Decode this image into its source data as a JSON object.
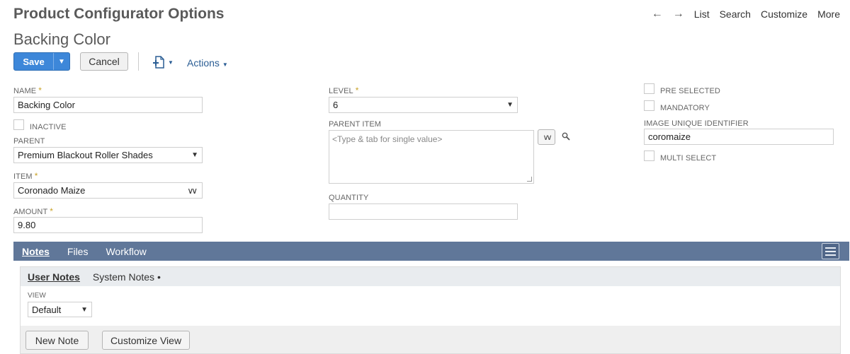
{
  "header": {
    "page_title": "Product Configurator Options",
    "record_name": "Backing Color",
    "nav": {
      "back_icon": "arrow-left-icon",
      "forward_icon": "arrow-right-icon",
      "list": "List",
      "search": "Search",
      "customize": "Customize",
      "more": "More"
    }
  },
  "toolbar": {
    "save_label": "Save",
    "cancel_label": "Cancel",
    "actions_label": "Actions",
    "accent_color": "#3d87d9"
  },
  "form": {
    "name": {
      "label": "NAME",
      "value": "Backing Color",
      "required": "*"
    },
    "inactive": {
      "label": "INACTIVE",
      "checked": false
    },
    "parent": {
      "label": "PARENT",
      "value": "Premium Blackout Roller Shades"
    },
    "item": {
      "label": "ITEM",
      "value": "Coronado Maize",
      "required": "*"
    },
    "amount": {
      "label": "AMOUNT",
      "value": "9.80",
      "required": "*"
    },
    "level": {
      "label": "LEVEL",
      "value": "6",
      "required": "*"
    },
    "parent_item": {
      "label": "PARENT ITEM",
      "placeholder": "<Type & tab for single value>"
    },
    "quantity": {
      "label": "QUANTITY",
      "value": ""
    },
    "pre_selected": {
      "label": "PRE SELECTED",
      "checked": false
    },
    "mandatory": {
      "label": "MANDATORY",
      "checked": false
    },
    "image_unique_identifier": {
      "label": "IMAGE UNIQUE IDENTIFIER",
      "value": "coromaize"
    },
    "multi_select": {
      "label": "MULTI SELECT",
      "checked": false
    }
  },
  "subtabs": {
    "tabs": [
      "Notes",
      "Files",
      "Workflow"
    ],
    "active": "Notes",
    "bar_color": "#607799",
    "inner_tabs": [
      "User Notes",
      "System Notes •"
    ],
    "view": {
      "label": "VIEW",
      "value": "Default"
    },
    "new_note_label": "New Note",
    "customize_view_label": "Customize View"
  }
}
